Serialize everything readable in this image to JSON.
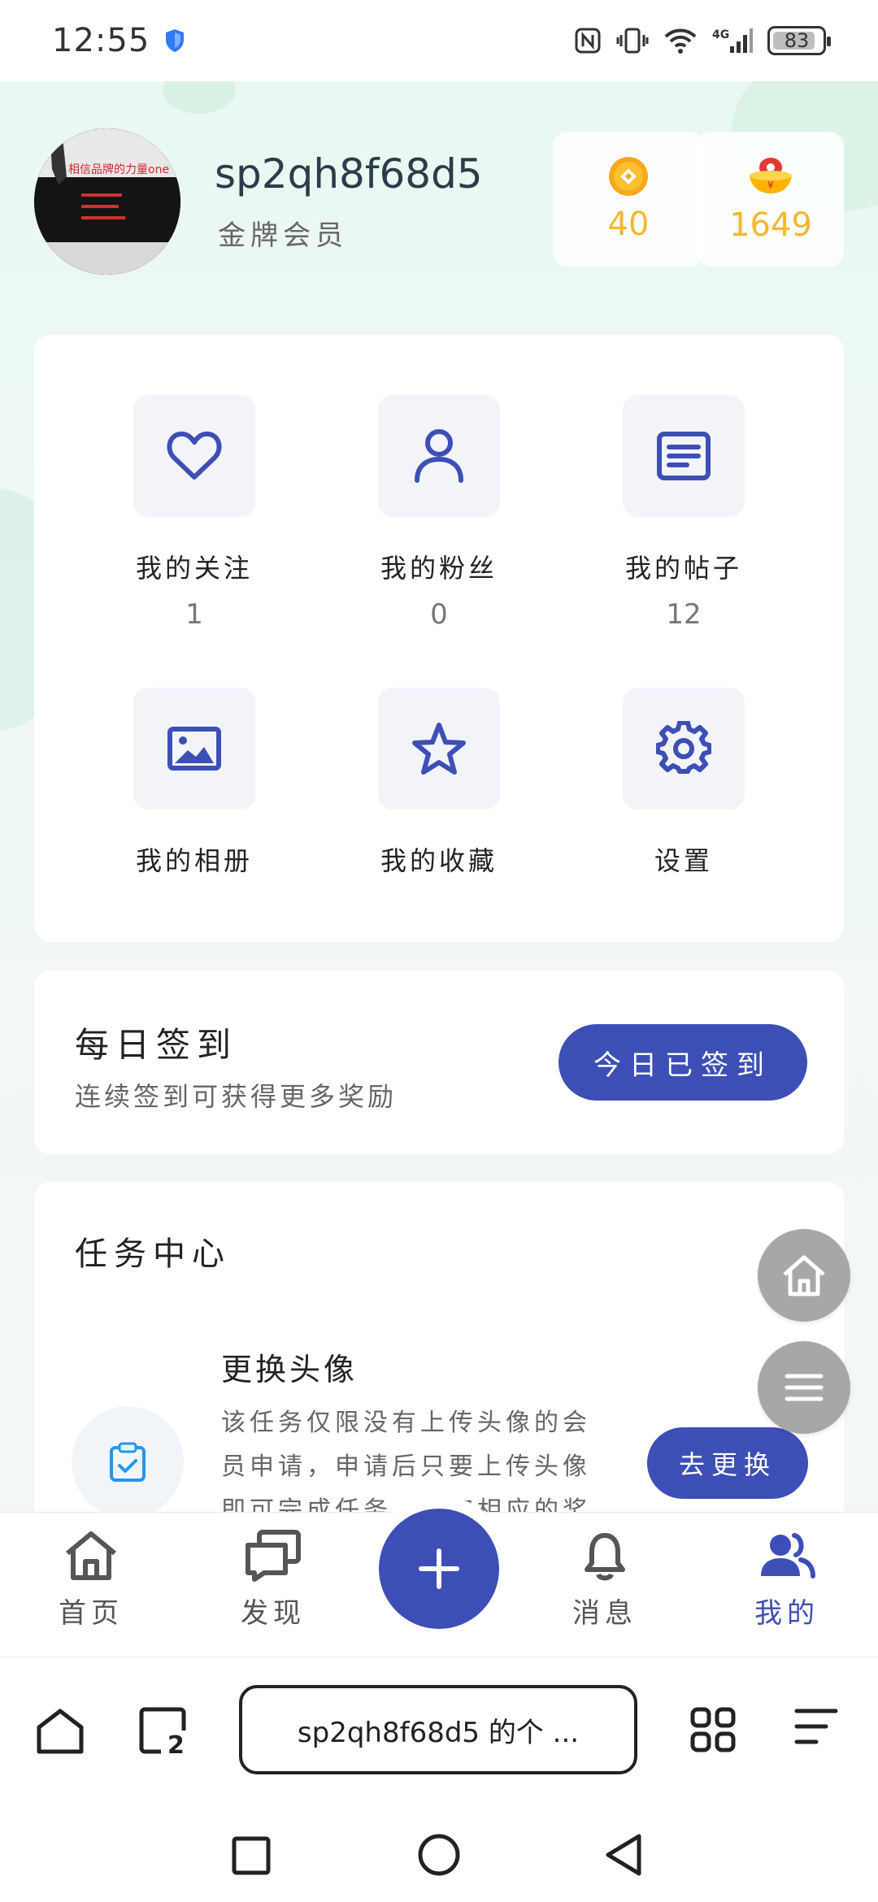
{
  "status_bar": {
    "time": "12:55",
    "battery": "83"
  },
  "profile": {
    "username": "sp2qh8f68d5",
    "member_level": "金牌会员",
    "coins": "40",
    "gold": "1649",
    "avatar_text": "相信品牌的力量one"
  },
  "grid": [
    {
      "label": "我的关注",
      "count": "1",
      "icon": "heart-icon"
    },
    {
      "label": "我的粉丝",
      "count": "0",
      "icon": "user-icon"
    },
    {
      "label": "我的帖子",
      "count": "12",
      "icon": "document-icon"
    },
    {
      "label": "我的相册",
      "icon": "image-icon"
    },
    {
      "label": "我的收藏",
      "icon": "star-icon"
    },
    {
      "label": "设置",
      "icon": "gear-icon"
    }
  ],
  "signin": {
    "title": "每日签到",
    "subtitle": "连续签到可获得更多奖励",
    "button": "今日已签到"
  },
  "tasks": {
    "title": "任务中心",
    "items": [
      {
        "name": "更换头像",
        "description": "该任务仅限没有上传头像的会员申请，申请后只要上传头像即可完成任务，领取相应的奖励",
        "button": "去更换"
      }
    ]
  },
  "tabbar": [
    {
      "label": "首页",
      "icon": "home-icon"
    },
    {
      "label": "发现",
      "icon": "discover-chat-icon"
    },
    {
      "label": "",
      "icon": "plus-icon"
    },
    {
      "label": "消息",
      "icon": "bell-icon"
    },
    {
      "label": "我的",
      "icon": "users-icon",
      "active": true
    }
  ],
  "browser": {
    "url_title": "sp2qh8f68d5 的个 ...",
    "tab_count": "2"
  },
  "colors": {
    "accent": "#3d4fb6",
    "coin": "#f5b731",
    "icon_tile": "#f3f4fa"
  }
}
